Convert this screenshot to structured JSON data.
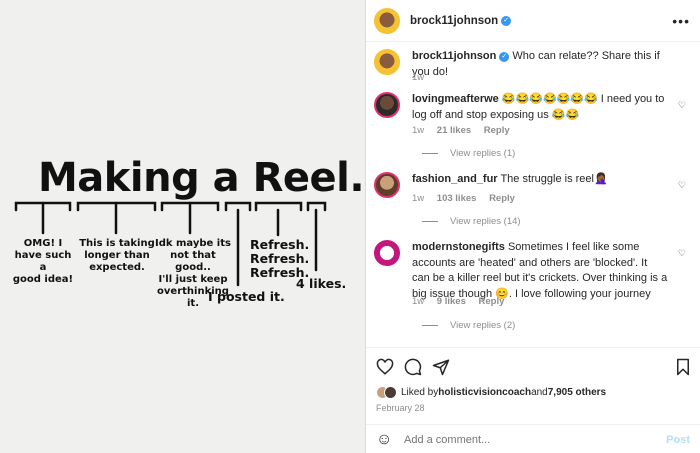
{
  "media": {
    "title": "Making a Reel.",
    "notes": [
      "OMG! I\nhave such a\ngood idea!",
      "This is taking\nlonger than\nexpected.",
      "Idk maybe its\nnot that good..\nI'll just keep\noverthinking it.",
      "Refresh.\nRefresh.\nRefresh.",
      "I posted it.",
      "4 likes."
    ]
  },
  "post": {
    "author": "brock11johnson",
    "more_icon": "more-horizontal-icon",
    "caption_author": "brock11johnson",
    "caption": "Who can relate?? Share this if you do!",
    "caption_time": "1w"
  },
  "comments": [
    {
      "user": "lovingmeafterwe",
      "text": "😂😂😂😂😂😂😂 I need you to log off and stop exposing us 😂😂",
      "time": "1w",
      "likes": "21 likes",
      "reply": "Reply",
      "view_replies": "View replies (1)"
    },
    {
      "user": "fashion_and_fur",
      "text": "The struggle is reel🤦🏾‍♀️",
      "time": "1w",
      "likes": "103 likes",
      "reply": "Reply",
      "view_replies": "View replies (14)"
    },
    {
      "user": "modernstonegifts",
      "text": "Sometimes I feel like some accounts are 'heated' and others are 'blocked'. It can be a killer reel but it's crickets. Over thinking is a big issue though 😊. I love following your journey",
      "time": "1w",
      "likes": "9 likes",
      "reply": "Reply",
      "view_replies": "View replies (2)"
    }
  ],
  "actions": {
    "liked_by_prefix": "Liked by ",
    "liked_by_user": "holisticvisioncoach",
    "liked_by_and": " and ",
    "liked_by_others": "7,905 others",
    "date": "February 28"
  },
  "add_comment": {
    "placeholder": "Add a comment...",
    "post_label": "Post"
  },
  "colors": {
    "verified": "#3897f0",
    "muted": "#8e8e8e",
    "post_disabled": "#b2dffc"
  }
}
